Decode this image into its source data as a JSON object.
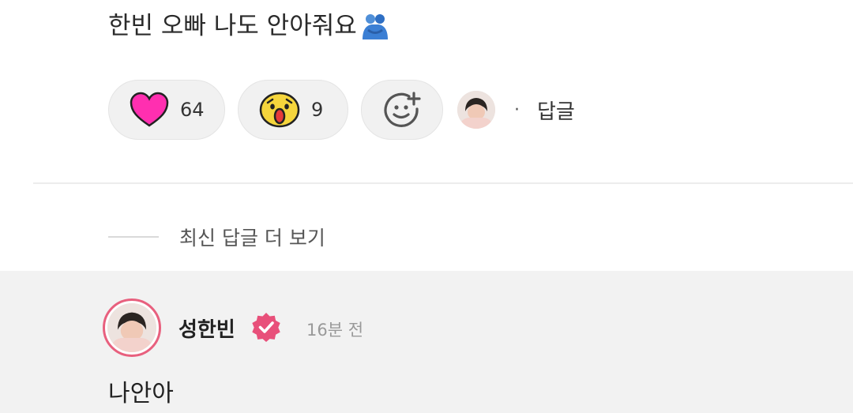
{
  "post": {
    "text": "한빈 오빠 나도 안아줘요",
    "emoji_icon": "people-hugging-icon"
  },
  "reactions": {
    "heart": {
      "icon": "heart-icon",
      "count": "64",
      "color": "#ff2fb0"
    },
    "wow": {
      "icon": "surprised-face-icon",
      "count": "9",
      "color": "#f5d53c"
    },
    "add": {
      "icon": "add-reaction-icon"
    }
  },
  "reply_link": "답글",
  "more_replies": "최신 답글 더 보기",
  "reply": {
    "name": "성한빈",
    "time": "16분 전",
    "text": "나안아",
    "badge_color": "#e8507a"
  }
}
